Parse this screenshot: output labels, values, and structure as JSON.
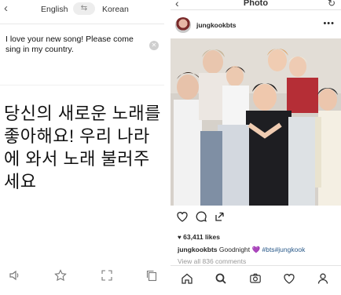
{
  "translator": {
    "back_icon": "chevron-left-icon",
    "source_lang": "English",
    "swap_icon": "swap-arrows-icon",
    "target_lang": "Korean",
    "input_text": "I love your new song! Please come sing in my country.",
    "clear_icon": "clear-x-icon",
    "output_text": "당신의 새로운 노래를 좋아해요! 우리 나라에 와서 노래 불러주세요",
    "toolbar": [
      {
        "icon": "speaker-icon"
      },
      {
        "icon": "star-icon"
      },
      {
        "icon": "fullscreen-icon"
      },
      {
        "icon": "copy-icon"
      }
    ]
  },
  "instagram": {
    "nav_title": "Photo",
    "back_icon": "chevron-left-icon",
    "refresh_icon": "refresh-icon",
    "username": "jungkookbts",
    "more_icon": "more-dots-icon",
    "actions": [
      "heart-icon",
      "comment-icon",
      "share-icon"
    ],
    "likes": "63,411 likes",
    "caption": {
      "user": "jungkookbts",
      "text": "Goodnight",
      "emoji": "💜",
      "tag1": "#bts",
      "tag2": "#jungkook"
    },
    "comments_link": "View all 836 comments",
    "tabs": [
      "home-icon",
      "search-icon",
      "camera-icon",
      "activity-heart-icon",
      "profile-icon"
    ]
  }
}
